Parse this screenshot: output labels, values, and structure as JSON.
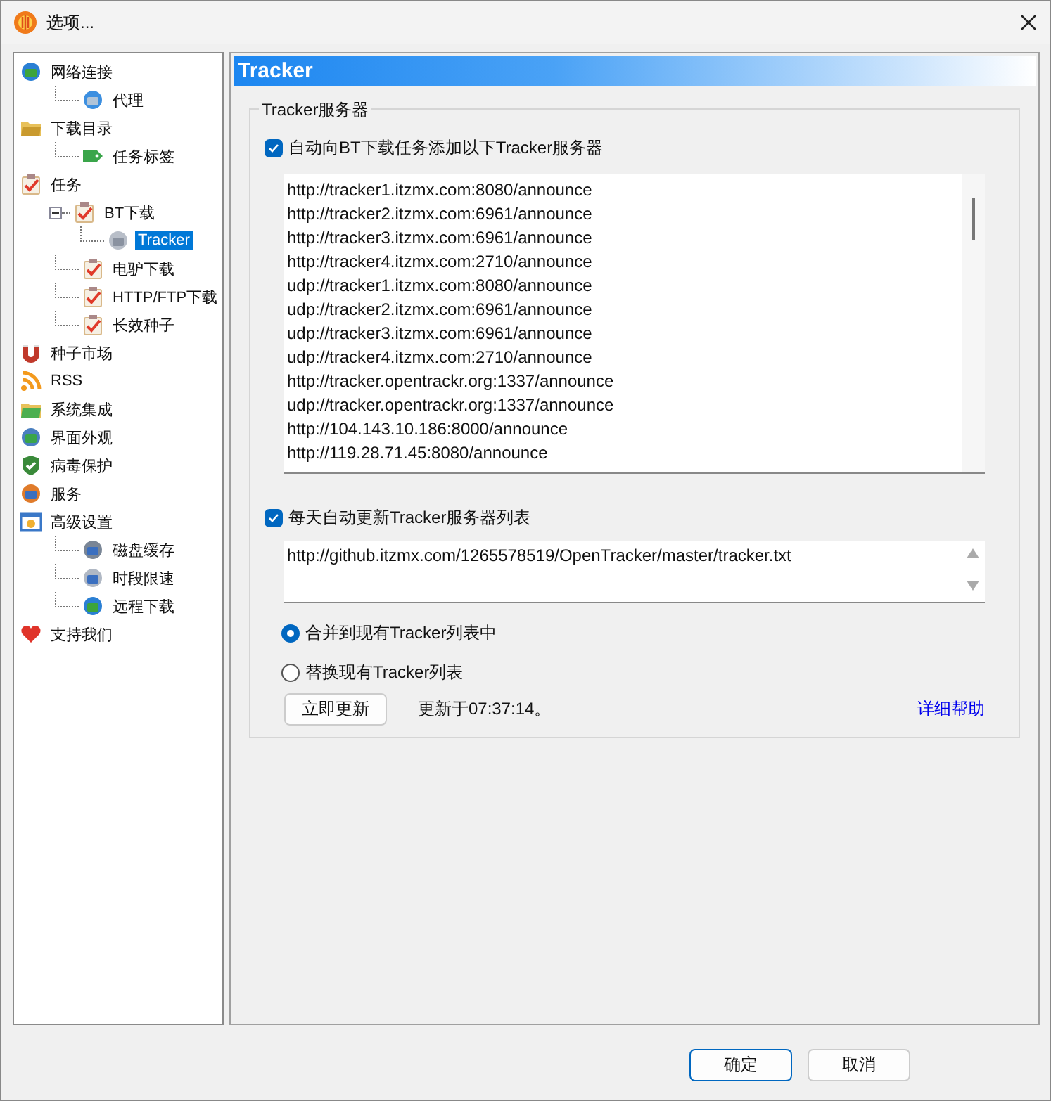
{
  "window": {
    "title": "选项..."
  },
  "sidebar": {
    "items": [
      {
        "label": "网络连接",
        "selected": false,
        "children": [
          {
            "label": "代理",
            "selected": false
          }
        ]
      },
      {
        "label": "下载目录",
        "selected": false,
        "children": [
          {
            "label": "任务标签",
            "selected": false
          }
        ]
      },
      {
        "label": "任务",
        "selected": false,
        "children": [
          {
            "label": "BT下载",
            "selected": false,
            "children": [
              {
                "label": "Tracker",
                "selected": true
              }
            ]
          },
          {
            "label": "电驴下载",
            "selected": false
          },
          {
            "label": "HTTP/FTP下载",
            "selected": false
          },
          {
            "label": "长效种子",
            "selected": false
          }
        ]
      },
      {
        "label": "种子市场",
        "selected": false
      },
      {
        "label": "RSS",
        "selected": false
      },
      {
        "label": "系统集成",
        "selected": false
      },
      {
        "label": "界面外观",
        "selected": false
      },
      {
        "label": "病毒保护",
        "selected": false
      },
      {
        "label": "服务",
        "selected": false
      },
      {
        "label": "高级设置",
        "selected": false,
        "children": [
          {
            "label": "磁盘缓存",
            "selected": false
          },
          {
            "label": "时段限速",
            "selected": false
          },
          {
            "label": "远程下载",
            "selected": false
          }
        ]
      },
      {
        "label": "支持我们",
        "selected": false
      }
    ]
  },
  "panel": {
    "title": "Tracker"
  },
  "group": {
    "title": "Tracker服务器"
  },
  "auto_add": {
    "label": "自动向BT下载任务添加以下Tracker服务器",
    "checked": true
  },
  "trackers": [
    "http://tracker1.itzmx.com:8080/announce",
    "http://tracker2.itzmx.com:6961/announce",
    "http://tracker3.itzmx.com:6961/announce",
    "http://tracker4.itzmx.com:2710/announce",
    "udp://tracker1.itzmx.com:8080/announce",
    "udp://tracker2.itzmx.com:6961/announce",
    "udp://tracker3.itzmx.com:6961/announce",
    "udp://tracker4.itzmx.com:2710/announce",
    "http://tracker.opentrackr.org:1337/announce",
    "udp://tracker.opentrackr.org:1337/announce",
    "http://104.143.10.186:8000/announce",
    "http://119.28.71.45:8080/announce"
  ],
  "auto_update": {
    "label": "每天自动更新Tracker服务器列表",
    "checked": true
  },
  "update_url": "http://github.itzmx.com/1265578519/OpenTracker/master/tracker.txt",
  "merge_options": [
    {
      "label": "合并到现有Tracker列表中",
      "selected": true
    },
    {
      "label": "替换现有Tracker列表",
      "selected": false
    }
  ],
  "update_button": "立即更新",
  "update_status": "更新于07:37:14。",
  "help_link": "详细帮助",
  "buttons": [
    "确定",
    "取消"
  ]
}
